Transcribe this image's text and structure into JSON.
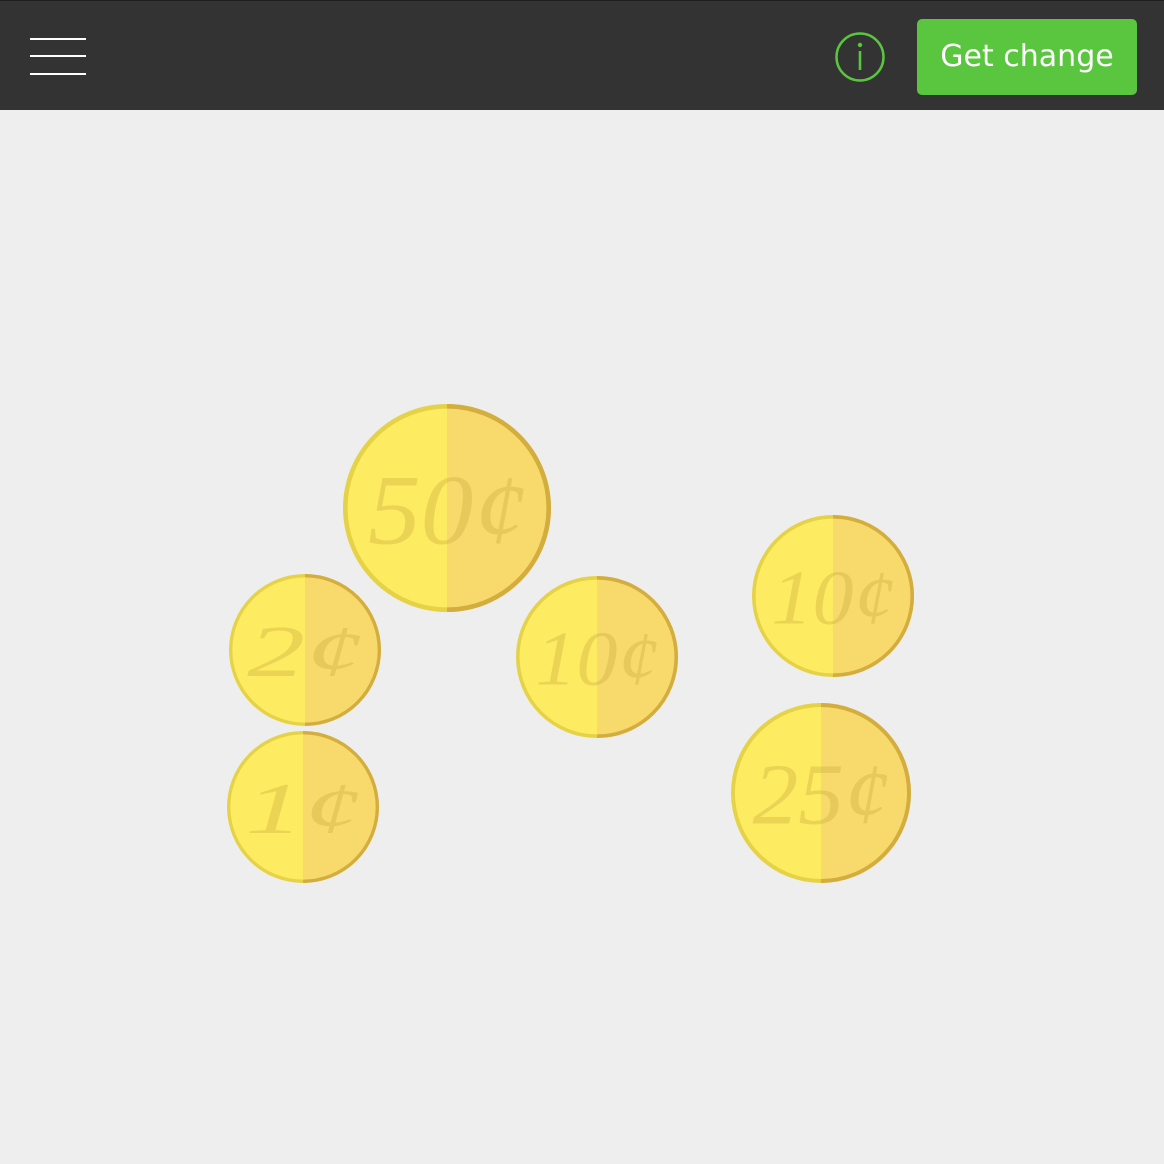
{
  "header": {
    "menu_icon": "hamburger-menu-icon",
    "info_icon": "info-circle-icon",
    "get_change_label": "Get change"
  },
  "colors": {
    "topbar": "#333333",
    "background": "#eeeeee",
    "accent_green": "#5ac53e",
    "coin_light": "#fdeb62",
    "coin_dark": "#f8d96c",
    "coin_rim_light": "#e6d247",
    "coin_rim_dark": "#d4ad3f"
  },
  "coins": [
    {
      "id": "50",
      "label": "50¢"
    },
    {
      "id": "2",
      "label": "2¢"
    },
    {
      "id": "10a",
      "label": "10¢"
    },
    {
      "id": "10b",
      "label": "10¢"
    },
    {
      "id": "1",
      "label": "1¢"
    },
    {
      "id": "25",
      "label": "25¢"
    }
  ]
}
